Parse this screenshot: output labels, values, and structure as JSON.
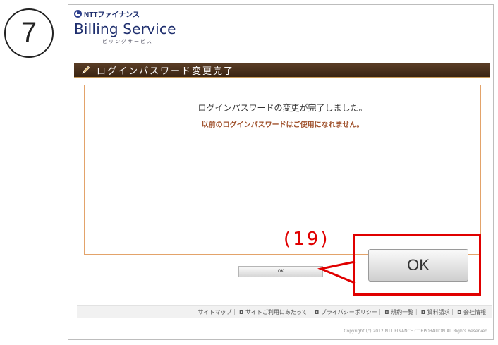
{
  "annotation": {
    "step_number": "7",
    "callout_label": "(19)",
    "zoomed_button_label": "OK",
    "color": "#e00000"
  },
  "logo": {
    "mark_icon": "ntt-logo-icon",
    "company": "NTTファイナンス",
    "service_title": "Billing Service",
    "service_reading": "ビリングサービス"
  },
  "section": {
    "icon": "pencil-icon",
    "title": "ログインパスワード変更完了"
  },
  "message": {
    "main": "ログインパスワードの変更が完了しました。",
    "notice": "以前のログインパスワードはご使用になれません。"
  },
  "actions": {
    "ok_label": "OK"
  },
  "footer": {
    "links_text": "サイトマップ｜ ◘ サイトご利用にあたって｜ ◘ プライバシーポリシー｜ ◘ 規約一覧｜ ◘ 資料請求｜ ◘ 会社情報",
    "copyright": "Copyright (c) 2012 NTT FINANCE CORPORATION All Rights Reserved."
  },
  "colors": {
    "section_bar": "#4a2f1b",
    "content_border": "#e3a36a",
    "notice_text": "#a0522d",
    "brand": "#1f2f6e"
  }
}
